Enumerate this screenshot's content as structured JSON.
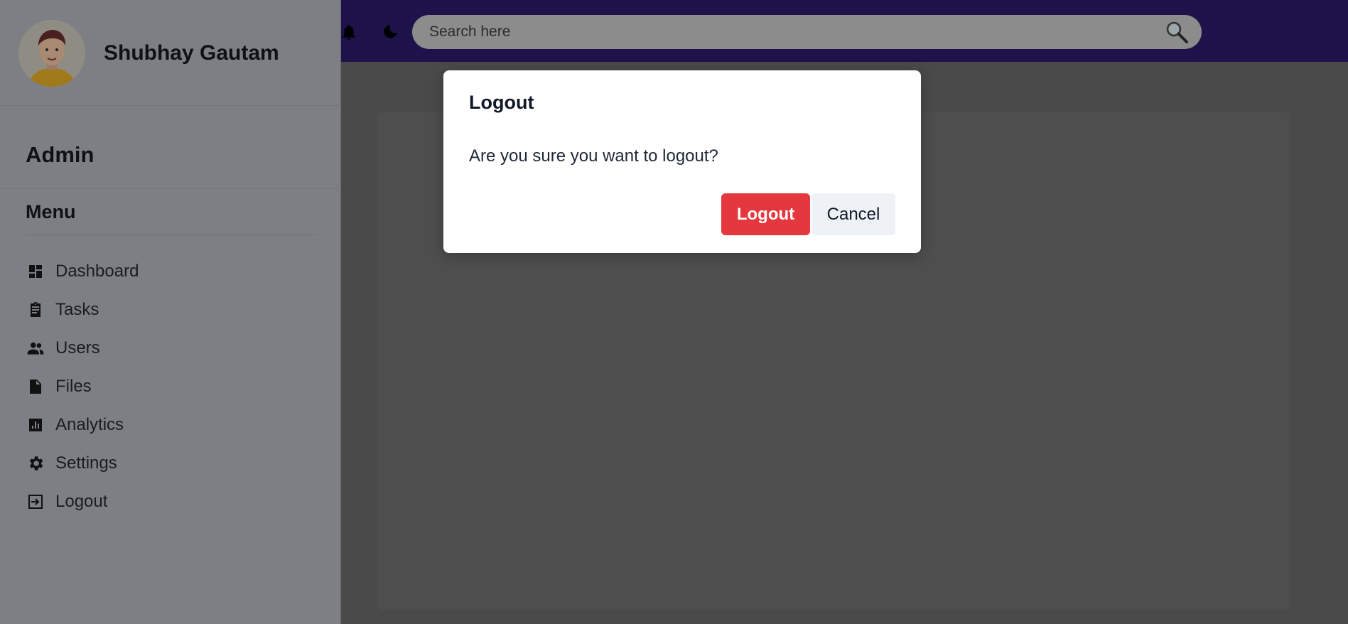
{
  "header": {
    "search_placeholder": "Search here",
    "icons": [
      "bell-icon",
      "moon-icon",
      "search-icon"
    ]
  },
  "sidebar": {
    "user_name": "Shubhay Gautam",
    "role": "Admin",
    "menu_title": "Menu",
    "items": [
      {
        "label": "Dashboard",
        "icon": "dashboard-icon"
      },
      {
        "label": "Tasks",
        "icon": "clipboard-icon"
      },
      {
        "label": "Users",
        "icon": "users-icon"
      },
      {
        "label": "Files",
        "icon": "file-icon"
      },
      {
        "label": "Analytics",
        "icon": "analytics-icon"
      },
      {
        "label": "Settings",
        "icon": "gear-icon"
      },
      {
        "label": "Logout",
        "icon": "logout-icon"
      }
    ]
  },
  "modal": {
    "title": "Logout",
    "message": "Are you sure you want to logout?",
    "confirm_label": "Logout",
    "cancel_label": "Cancel"
  },
  "colors": {
    "topbar": "#1d1249",
    "confirm": "#e5383e",
    "cancel": "#eef1f5"
  }
}
